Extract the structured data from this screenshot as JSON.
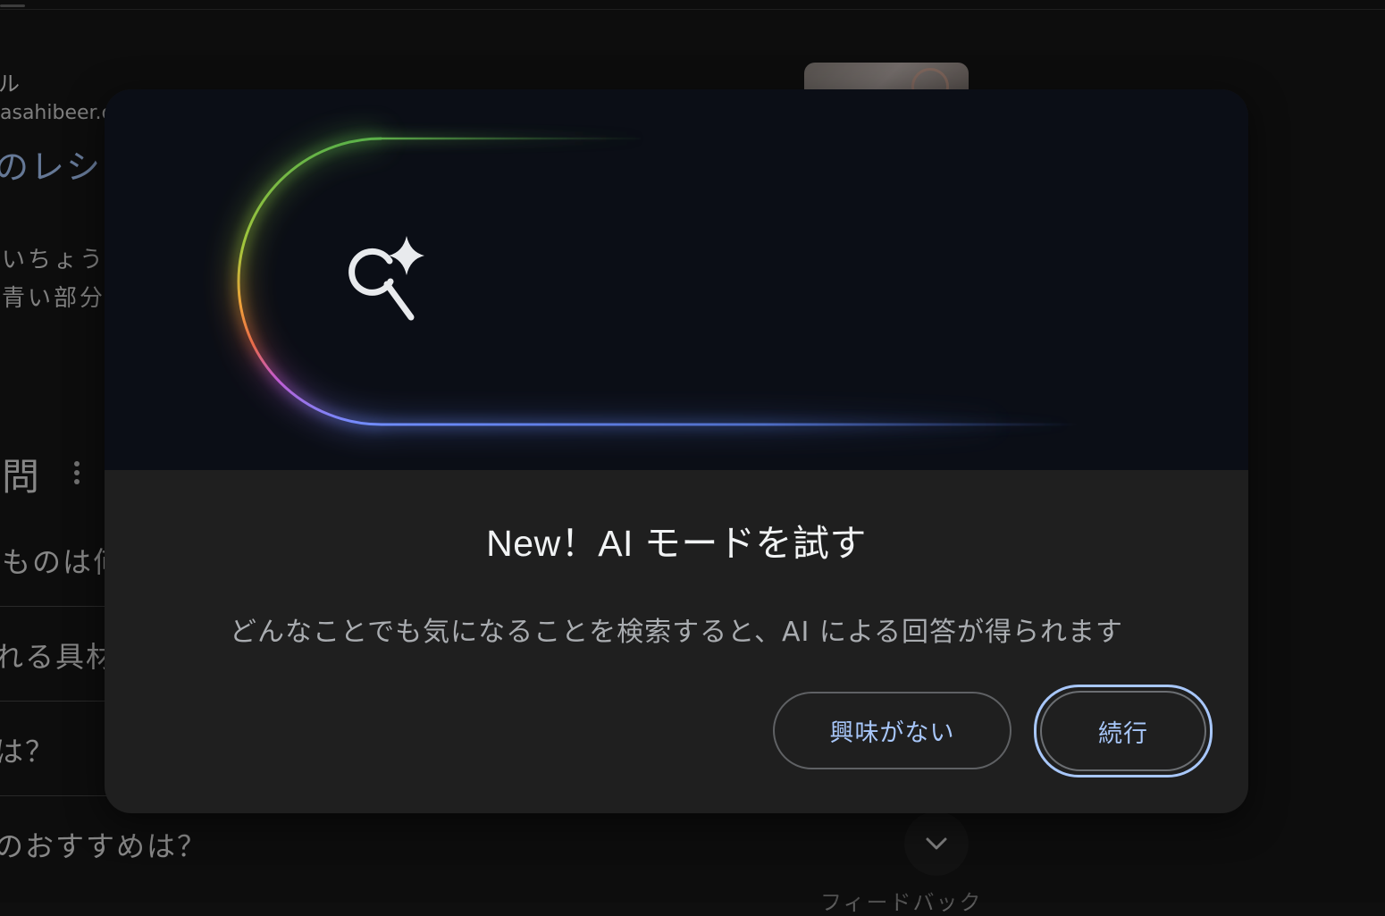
{
  "background": {
    "site_name": "ル",
    "site_url": "asahibeer.co",
    "result_title": "のレシピ",
    "snippet_line1": "いちょうで",
    "snippet_line2": "青い部分の",
    "section_heading": "問",
    "questions": [
      "ものは何",
      "れる具材",
      "は？",
      "のおすすめは？"
    ],
    "feedback_label": "フィードバック"
  },
  "dialog": {
    "title": "New！AI モードを試す",
    "description": "どんなことでも気になることを検索すると、AI による回答が得られます",
    "decline_label": "興味がない",
    "continue_label": "続行",
    "hero_icon": "ai-search-sparkle-icon"
  },
  "colors": {
    "accent": "#a8c7fa",
    "dialog_bg": "#1f1f1f",
    "hero_bg": "#0b0e16"
  }
}
